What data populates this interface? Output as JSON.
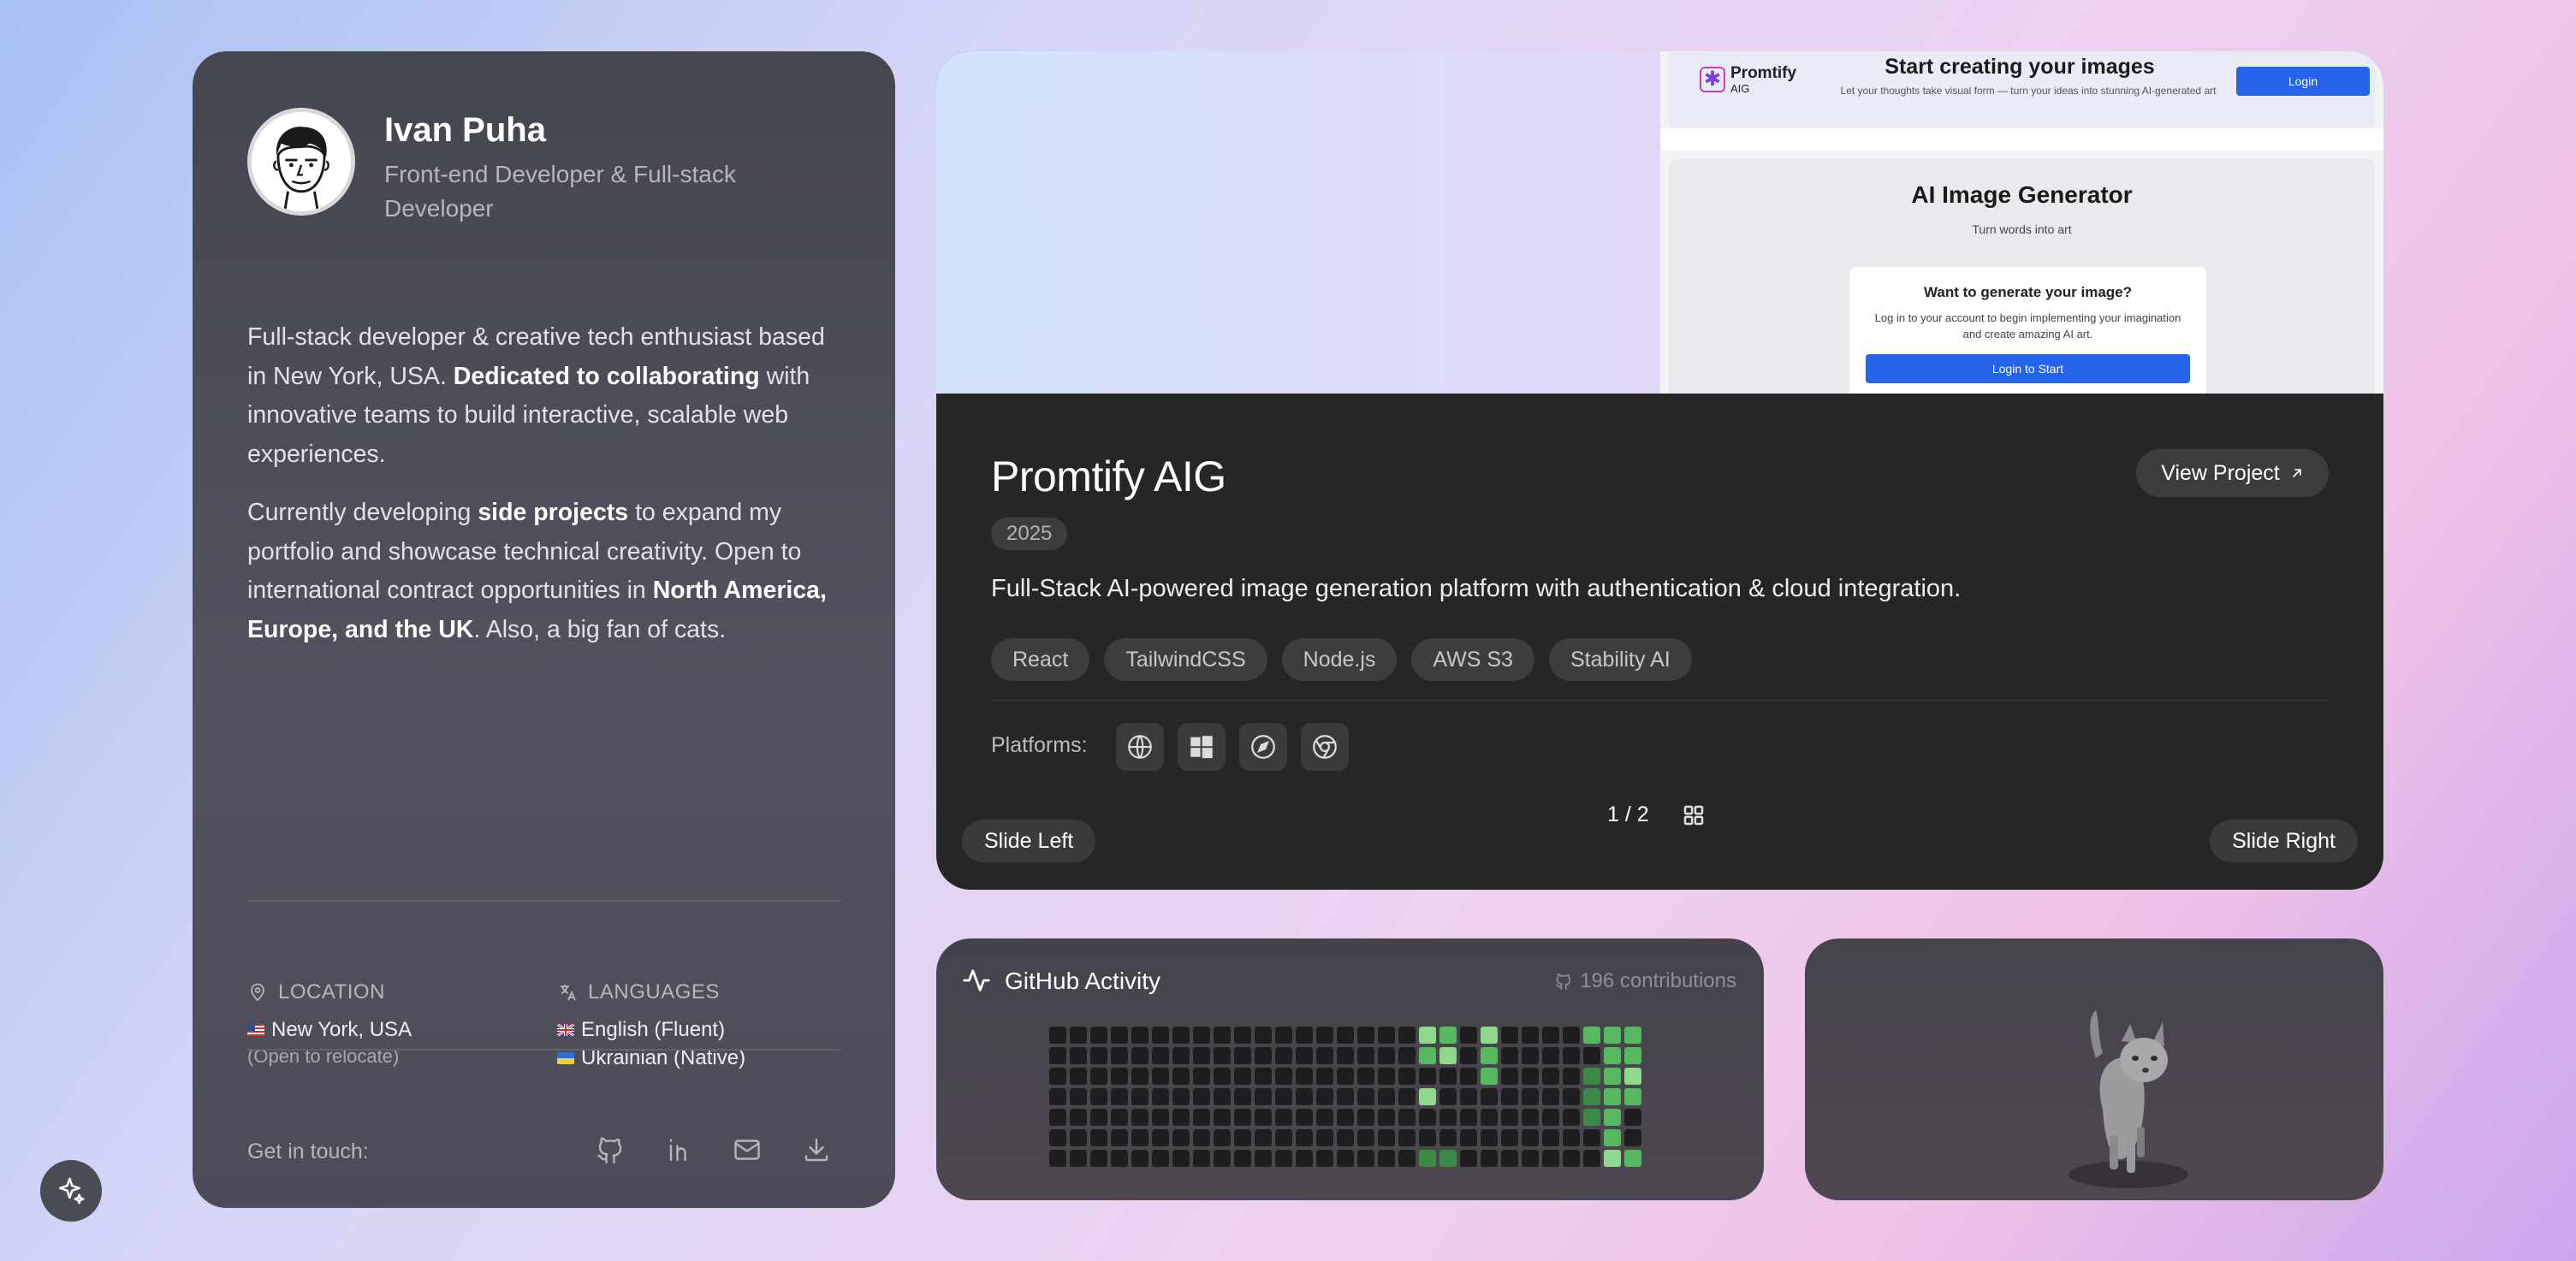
{
  "profile": {
    "name": "Ivan Puha",
    "role": "Front-end Developer & Full-stack Developer",
    "bio1": {
      "t1": "Full-stack developer & creative tech enthusiast based in New York, USA. ",
      "b1": "Dedicated to collaborating",
      "t2": " with innovative teams to build interactive, scalable web experiences."
    },
    "bio2": {
      "t1": "Currently developing ",
      "b1": "side projects",
      "t2": " to expand my portfolio and showcase technical creativity. Open to international contract opportunities in ",
      "b2": "North America, Europe, and the UK",
      "t3": ". Also, a big fan of cats."
    },
    "location": {
      "label": "LOCATION",
      "value": "New York, USA",
      "note": "(Open to relocate)"
    },
    "languages": {
      "label": "LANGUAGES",
      "items": [
        "English (Fluent)",
        "Ukrainian (Native)"
      ]
    },
    "contact_label": "Get in touch:",
    "contact_icons": [
      "github-icon",
      "linkedin-icon",
      "mail-icon",
      "download-icon"
    ]
  },
  "project": {
    "preview": {
      "logo_name": "Promtify",
      "logo_sub": "AIG",
      "header_title": "Start creating your images",
      "header_sub": "Let your thoughts take visual form — turn your ideas into stunning AI-generated art",
      "login": "Login",
      "heading": "AI Image Generator",
      "subheading": "Turn words into art",
      "box_title": "Want to generate your image?",
      "box_text": "Log in to your account to begin implementing your imagination and create amazing AI art.",
      "box_button": "Login to Start"
    },
    "title": "Promtify AIG",
    "year": "2025",
    "view_button": "View Project",
    "description": "Full-Stack AI-powered image generation platform with authentication & cloud integration.",
    "tags": [
      "React",
      "TailwindCSS",
      "Node.js",
      "AWS S3",
      "Stability AI"
    ],
    "platforms_label": "Platforms:",
    "platform_icons": [
      "globe-icon",
      "windows-icon",
      "safari-icon",
      "chrome-icon"
    ],
    "slide_left": "Slide Left",
    "slide_right": "Slide Right",
    "page_indicator": "1 / 2"
  },
  "github": {
    "title": "GitHub Activity",
    "contributions": "196 contributions",
    "colors": {
      "empty": "#1e1e1f",
      "l1": "#3a8a45",
      "l2": "#56b85f",
      "l3": "#8fd98c"
    },
    "weeks": 29,
    "grid": [
      "000000000000000000320300002220",
      "000000000000000000230200000221",
      "000000000000000000000200001230",
      "000000000000000000300000001220",
      "000000000000000000000000001200",
      "000000000000000000000000000200",
      "000000000000000000110000000320"
    ]
  },
  "theme": {
    "accent": "#2563eb",
    "card_dark": "#262626"
  }
}
